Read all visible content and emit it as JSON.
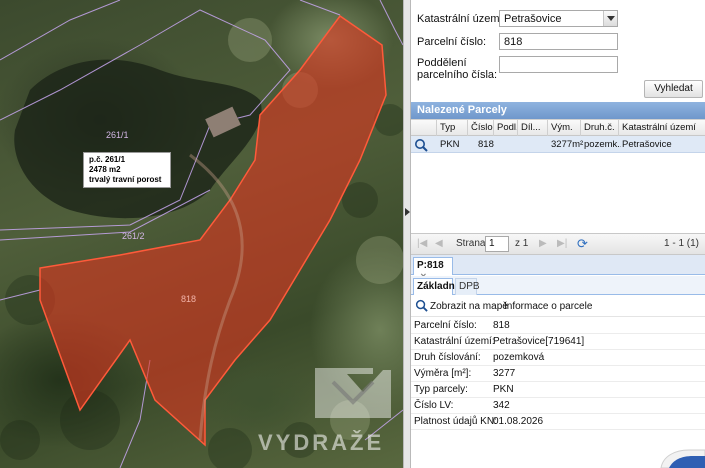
{
  "map": {
    "parcel_label_top": "261/1",
    "parcel_label_mid": "261/2",
    "parcel_label_selected": "818",
    "info_box": {
      "line1": "p.č. 261/1",
      "line2": "2478 m2",
      "line3": "trvalý travní porost"
    },
    "watermark_text": "VYDRAŽE",
    "selected_color": "#e0351f",
    "boundary_color": "#c7a6f0"
  },
  "search": {
    "cadastral_label": "Katastrální území:",
    "cadastral_value": "Petrašovice",
    "parcel_number_label": "Parcelní číslo:",
    "parcel_number_value": "818",
    "subdivision_label_1": "Poddělení",
    "subdivision_label_2": "parcelního čísla:",
    "subdivision_value": "",
    "search_button": "Vyhledat"
  },
  "results": {
    "title": "Nalezené Parcely",
    "columns": [
      "Typ",
      "Číslo...",
      "Podl...",
      "Díl...",
      "Vým.",
      "Druh.č.",
      "Katastrální území"
    ],
    "rows": [
      {
        "typ": "PKN",
        "cislo": "818",
        "podl": "",
        "dil": "",
        "vymera": "3277m²",
        "druh": "pozemk...",
        "ku": "Petrašovice"
      }
    ]
  },
  "pager": {
    "page_label": "Strana",
    "page_value": "1",
    "of_label": "z 1",
    "range_label": "1 - 1 (1)"
  },
  "detail": {
    "tab_label": "P:818",
    "subtab_basic": "Základní",
    "subtab_dpb": "DPB",
    "zoom_to_map": "Zobrazit na mapě",
    "parcel_info": "Informace o parcele",
    "fields": [
      {
        "key": "Parcelní číslo:",
        "value": "818"
      },
      {
        "key": "Katastrální území:",
        "value": "Petrašovice[719641]"
      },
      {
        "key": "Druh číslování:",
        "value": "pozemková"
      },
      {
        "key": "Výměra [m²]:",
        "value": "3277"
      },
      {
        "key": "Typ parcely:",
        "value": "PKN"
      },
      {
        "key": "Číslo LV:",
        "value": "342"
      },
      {
        "key": "Platnost údajů KN:",
        "value": "01.08.2026"
      }
    ]
  },
  "colors": {
    "header_blue": "#7ea4d6",
    "selected_row": "#dfe9f6"
  }
}
